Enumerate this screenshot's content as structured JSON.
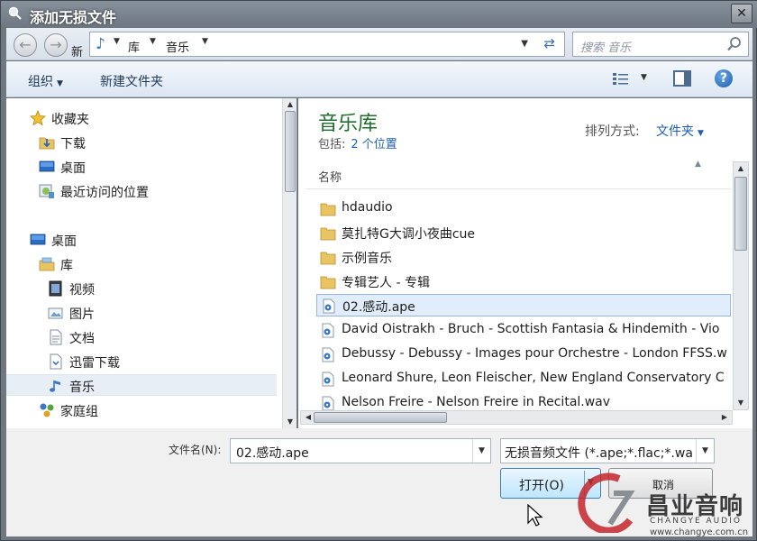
{
  "window": {
    "title": "添加无损文件",
    "close_label": "✕"
  },
  "navbar": {
    "new_truncated": "新",
    "breadcrumbs": [
      "库",
      "音乐"
    ],
    "search_placeholder": "搜索 音乐"
  },
  "toolbar": {
    "organize_label": "组织",
    "new_folder_label": "新建文件夹"
  },
  "sidebar": {
    "favorites": [
      {
        "label": "收藏夹",
        "icon": "star-icon"
      },
      {
        "label": "下载",
        "icon": "download-folder-icon"
      },
      {
        "label": "桌面",
        "icon": "desktop-icon"
      },
      {
        "label": "最近访问的位置",
        "icon": "recent-places-icon"
      }
    ],
    "tree": [
      {
        "label": "桌面",
        "icon": "desktop-icon"
      },
      {
        "label": "库",
        "icon": "library-icon"
      },
      {
        "label": "视频",
        "icon": "video-library-icon"
      },
      {
        "label": "图片",
        "icon": "pictures-library-icon"
      },
      {
        "label": "文档",
        "icon": "documents-library-icon"
      },
      {
        "label": "迅雷下载",
        "icon": "thunder-download-icon"
      },
      {
        "label": "音乐",
        "icon": "music-library-icon",
        "selected": true
      },
      {
        "label": "家庭组",
        "icon": "homegroup-icon"
      }
    ]
  },
  "content": {
    "library_title": "音乐库",
    "includes_label": "包括:",
    "includes_link": "2 个位置",
    "sort_label": "排列方式:",
    "sort_value": "文件夹",
    "column_name": "名称",
    "items": [
      {
        "name": "hdaudio",
        "type": "folder"
      },
      {
        "name": "莫扎特G大调小夜曲cue",
        "type": "folder"
      },
      {
        "name": "示例音乐",
        "type": "folder"
      },
      {
        "name": "专辑艺人 - 专辑",
        "type": "folder"
      },
      {
        "name": "02.感动.ape",
        "type": "audio",
        "selected": true
      },
      {
        "name": "David Oistrakh - Bruch - Scottish Fantasia & Hindemith - Vio",
        "type": "audio"
      },
      {
        "name": "Debussy - Debussy - Images pour Orchestre - London FFSS.w",
        "type": "audio"
      },
      {
        "name": "Leonard Shure, Leon Fleischer, New England Conservatory C",
        "type": "audio"
      },
      {
        "name": "Nelson Freire - Nelson Freire in Recital.wav",
        "type": "audio"
      }
    ]
  },
  "footer": {
    "filename_label": "文件名(N):",
    "filename_value": "02.感动.ape",
    "filter_value": "无损音频文件 (*.ape;*.flac;*.wa",
    "open_label": "打开(O)",
    "cancel_label": "取消"
  },
  "watermark": {
    "name": "昌业音响",
    "english": "CHANGYE AUDIO",
    "url": "www.changye.com.cn"
  },
  "colors": {
    "library_title": "#1e6f2d",
    "link": "#1f5fb0",
    "selection": "#e1edfa",
    "window_frame": "#6f7781"
  }
}
